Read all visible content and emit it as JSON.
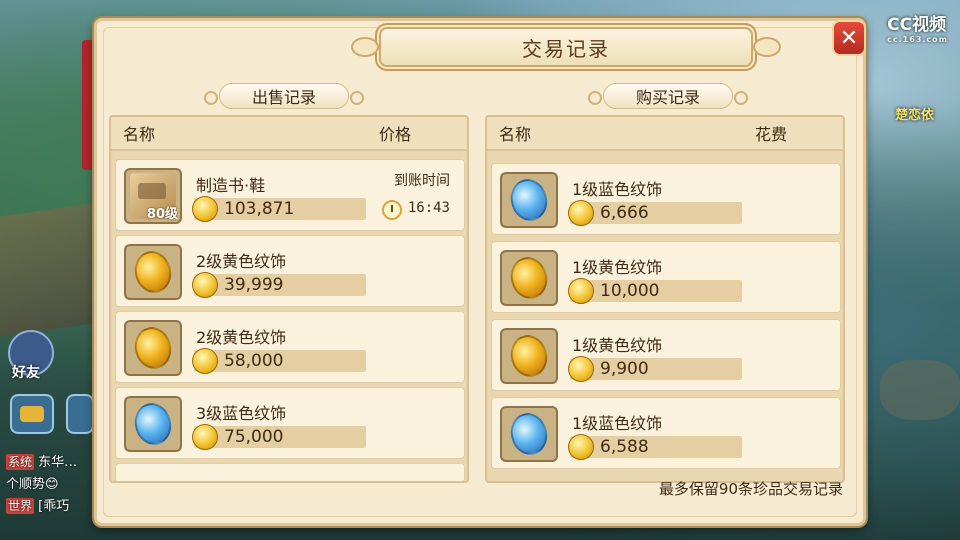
{
  "overlay": {
    "logo_text": "CC视频",
    "logo_sub": "cc.163.com",
    "side_name": "楚恋依",
    "friend_label": "好友"
  },
  "chat": [
    {
      "tag": "系统",
      "text": "东华…"
    },
    {
      "tag": "",
      "text": "个顺势😊"
    },
    {
      "tag": "世界",
      "text": "[乖巧"
    }
  ],
  "panel": {
    "title": "交易记录",
    "close_icon": "close-icon",
    "footer_note": "最多保留90条珍品交易记录"
  },
  "sell": {
    "tab_label": "出售记录",
    "col_name": "名称",
    "col_price": "价格",
    "arrive_label": "到账时间",
    "rows": [
      {
        "name": "制造书·鞋",
        "price": "103,871",
        "icon": "book-icon",
        "level": "80级",
        "arrive_time": "16:43"
      },
      {
        "name": "2级黄色纹饰",
        "price": "39,999",
        "icon": "gold-gem-icon"
      },
      {
        "name": "2级黄色纹饰",
        "price": "58,000",
        "icon": "gold-gem-icon"
      },
      {
        "name": "3级蓝色纹饰",
        "price": "75,000",
        "icon": "blue-gem-icon"
      }
    ]
  },
  "buy": {
    "tab_label": "购买记录",
    "col_name": "名称",
    "col_price": "花费",
    "rows": [
      {
        "name": "1级蓝色纹饰",
        "price": "6,666",
        "icon": "blue-gem-icon"
      },
      {
        "name": "1级黄色纹饰",
        "price": "10,000",
        "icon": "gold-gem-icon"
      },
      {
        "name": "1级黄色纹饰",
        "price": "9,900",
        "icon": "gold-gem-icon"
      },
      {
        "name": "1级蓝色纹饰",
        "price": "6,588",
        "icon": "blue-gem-icon"
      }
    ]
  },
  "colors": {
    "panel_bg": "#f6ead0",
    "text": "#3f2c16",
    "close_red": "#d63a2e"
  }
}
